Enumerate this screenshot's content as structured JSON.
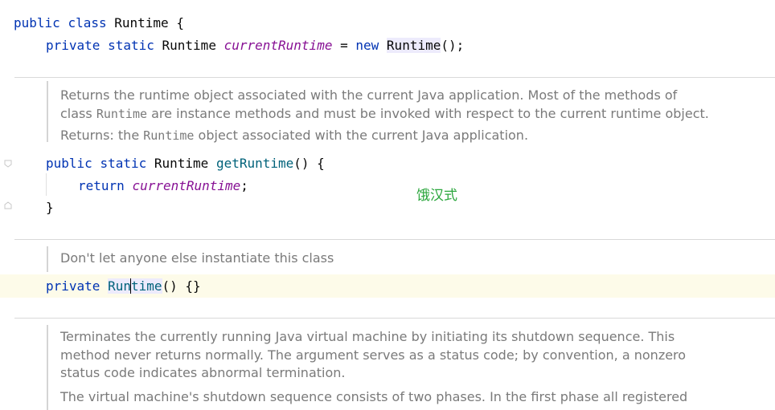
{
  "code": {
    "line1": {
      "kw1": "public",
      "kw2": "class",
      "cls": "Runtime",
      "brace": "{"
    },
    "line2": {
      "kw1": "private",
      "kw2": "static",
      "type": "Runtime",
      "field": "currentRuntime",
      "eq": "=",
      "kw3": "new",
      "ctor": "Runtime",
      "tail": "();"
    },
    "line3": {
      "kw1": "public",
      "kw2": "static",
      "type": "Runtime",
      "method": "getRuntime",
      "tail": "() {"
    },
    "line4": {
      "kw": "return",
      "field": "currentRuntime",
      "semi": ";"
    },
    "line5": {
      "brace": "}"
    },
    "line6": {
      "kw": "private",
      "ctor_a": "Run",
      "ctor_b": "time",
      "tail": "() {}"
    }
  },
  "docs": {
    "doc1": {
      "l1": "Returns the runtime object associated with the current Java application. Most of the methods of",
      "l2a": "class ",
      "l2b": "Runtime",
      "l2c": " are instance methods and must be invoked with respect to the current runtime object.",
      "l3a": "Returns: the ",
      "l3b": "Runtime",
      "l3c": " object associated with the current Java application."
    },
    "doc2": {
      "l1": "Don't let anyone else instantiate this class"
    },
    "doc3": {
      "l1": "Terminates the currently running Java virtual machine by initiating its shutdown sequence. This",
      "l2": "method never returns normally. The argument serves as a status code; by convention, a nonzero",
      "l3": "status code indicates abnormal termination.",
      "l4": "The virtual machine's shutdown sequence consists of two phases. In the first phase all registered"
    }
  },
  "annotation": "饿汉式",
  "colors": {
    "keyword": "#0033b3",
    "field": "#871094",
    "method": "#00627a",
    "doc_text": "#7a7a7a",
    "annotation": "#2aa63c",
    "current_line": "#fdfbe9"
  }
}
